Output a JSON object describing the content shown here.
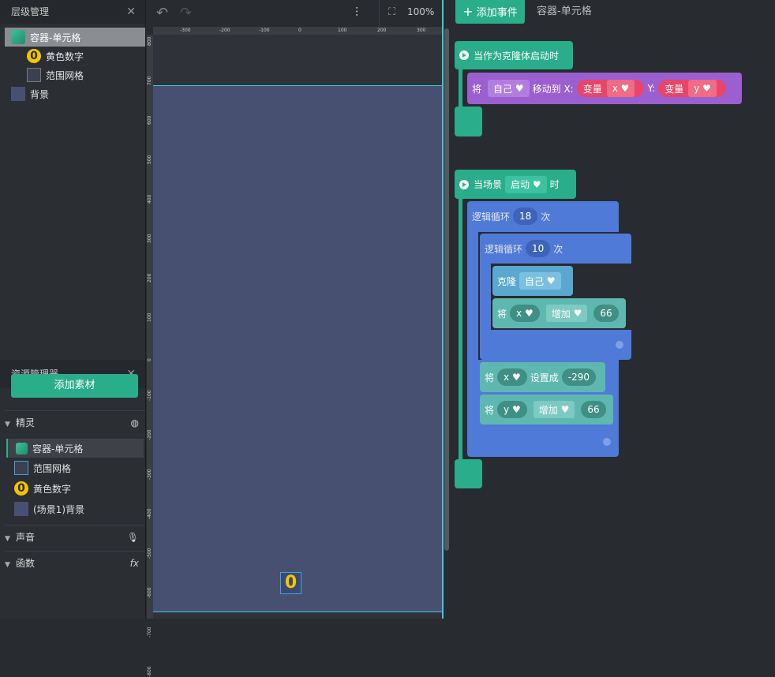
{
  "layers": {
    "title": "层级管理",
    "items": [
      {
        "label": "容器-单元格"
      },
      {
        "label": "黄色数字"
      },
      {
        "label": "范围网格"
      },
      {
        "label": "背景"
      }
    ]
  },
  "assets": {
    "title": "资源管理器",
    "add_button": "添加素材",
    "sprites_label": "精灵",
    "sprites": [
      {
        "label": "容器-单元格"
      },
      {
        "label": "范围网格"
      },
      {
        "label": "黄色数字"
      },
      {
        "label": "(场景1)背景"
      }
    ],
    "sound_label": "声音",
    "func_label": "函数",
    "func_icon_text": "fx"
  },
  "stage": {
    "zoom": "100%",
    "ruler_top": [
      "-300",
      "-200",
      "-100",
      "0",
      "100",
      "200",
      "300"
    ],
    "ruler_left": [
      "800",
      "700",
      "600",
      "500",
      "400",
      "300",
      "200",
      "100",
      "0",
      "-100",
      "-200",
      "-300",
      "-400",
      "-500",
      "-600",
      "-700",
      "-800"
    ],
    "sprite_text": "0"
  },
  "editor": {
    "add_event": "添加事件",
    "tab": "容器-单元格"
  },
  "blocks": {
    "clone_start": "当作为克隆体启动时",
    "move_prefix": "将",
    "move_self": "自己",
    "move_to_x": "移动到 X:",
    "var1": "变量",
    "var_x": "x",
    "y_label": "Y:",
    "var2": "变量",
    "var_y": "y",
    "scene_when": "当场景",
    "scene_event": "启动",
    "scene_suffix": "时",
    "loop1_label": "逻辑循环",
    "loop1_count": "18",
    "loop1_unit": "次",
    "loop2_label": "逻辑循环",
    "loop2_count": "10",
    "loop2_unit": "次",
    "clone_label": "克隆",
    "clone_target": "自己",
    "inc_x_prefix": "将",
    "inc_x_var": "x",
    "inc_x_op": "增加",
    "inc_x_val": "66",
    "set_x_prefix": "将",
    "set_x_var": "x",
    "set_x_op": "设置成",
    "set_x_val": "-290",
    "inc_y_prefix": "将",
    "inc_y_var": "y",
    "inc_y_op": "增加",
    "inc_y_val": "66"
  }
}
